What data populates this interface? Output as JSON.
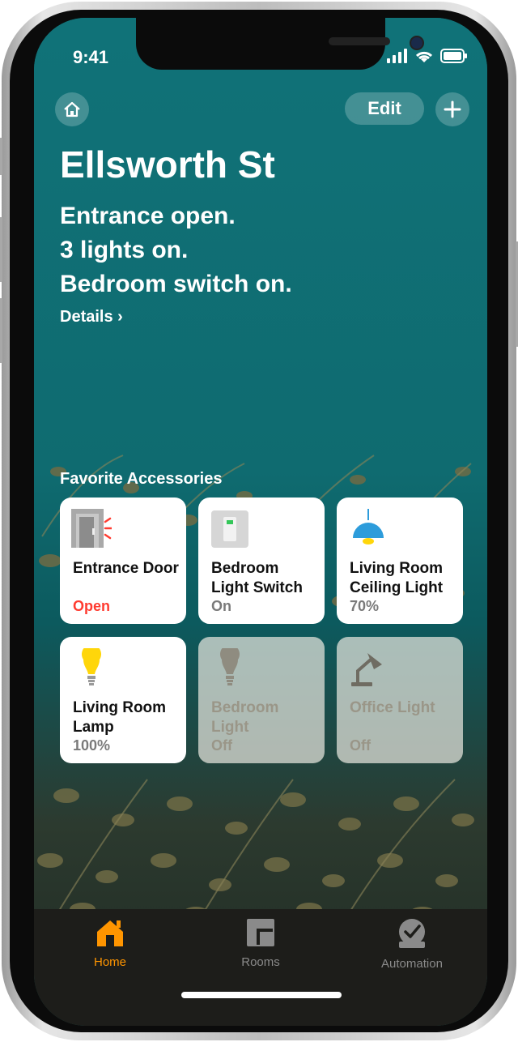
{
  "status_bar": {
    "time": "9:41"
  },
  "header": {
    "edit_label": "Edit"
  },
  "home": {
    "title": "Ellsworth St",
    "summary": [
      "Entrance open.",
      "3 lights on.",
      "Bedroom switch on."
    ],
    "details_label": "Details",
    "details_chevron": "›"
  },
  "favorites": {
    "title": "Favorite Accessories",
    "tiles": [
      {
        "name": "Entrance Door",
        "state": "Open",
        "icon": "door-icon",
        "active": true
      },
      {
        "name": "Bedroom Light Switch",
        "state": "On",
        "icon": "switch-icon",
        "active": true
      },
      {
        "name": "Living Room Ceiling Light",
        "state": "70%",
        "icon": "ceiling-light-icon",
        "active": true
      },
      {
        "name": "Living Room Lamp",
        "state": "100%",
        "icon": "bulb-icon",
        "active": true
      },
      {
        "name": "Bedroom Light",
        "state": "Off",
        "icon": "bulb-icon",
        "active": false
      },
      {
        "name": "Office Light",
        "state": "Off",
        "icon": "desk-lamp-icon",
        "active": false
      }
    ]
  },
  "tabbar": {
    "tabs": [
      {
        "label": "Home",
        "icon": "house-icon",
        "selected": true
      },
      {
        "label": "Rooms",
        "icon": "rooms-icon",
        "selected": false
      },
      {
        "label": "Automation",
        "icon": "automation-icon",
        "selected": false
      }
    ]
  },
  "colors": {
    "accent": "#ff9500",
    "alert": "#ff3b30",
    "wall": "#0f6d72",
    "bulb_on": "#ffd60a",
    "ceiling_shade": "#2d9cdb"
  }
}
